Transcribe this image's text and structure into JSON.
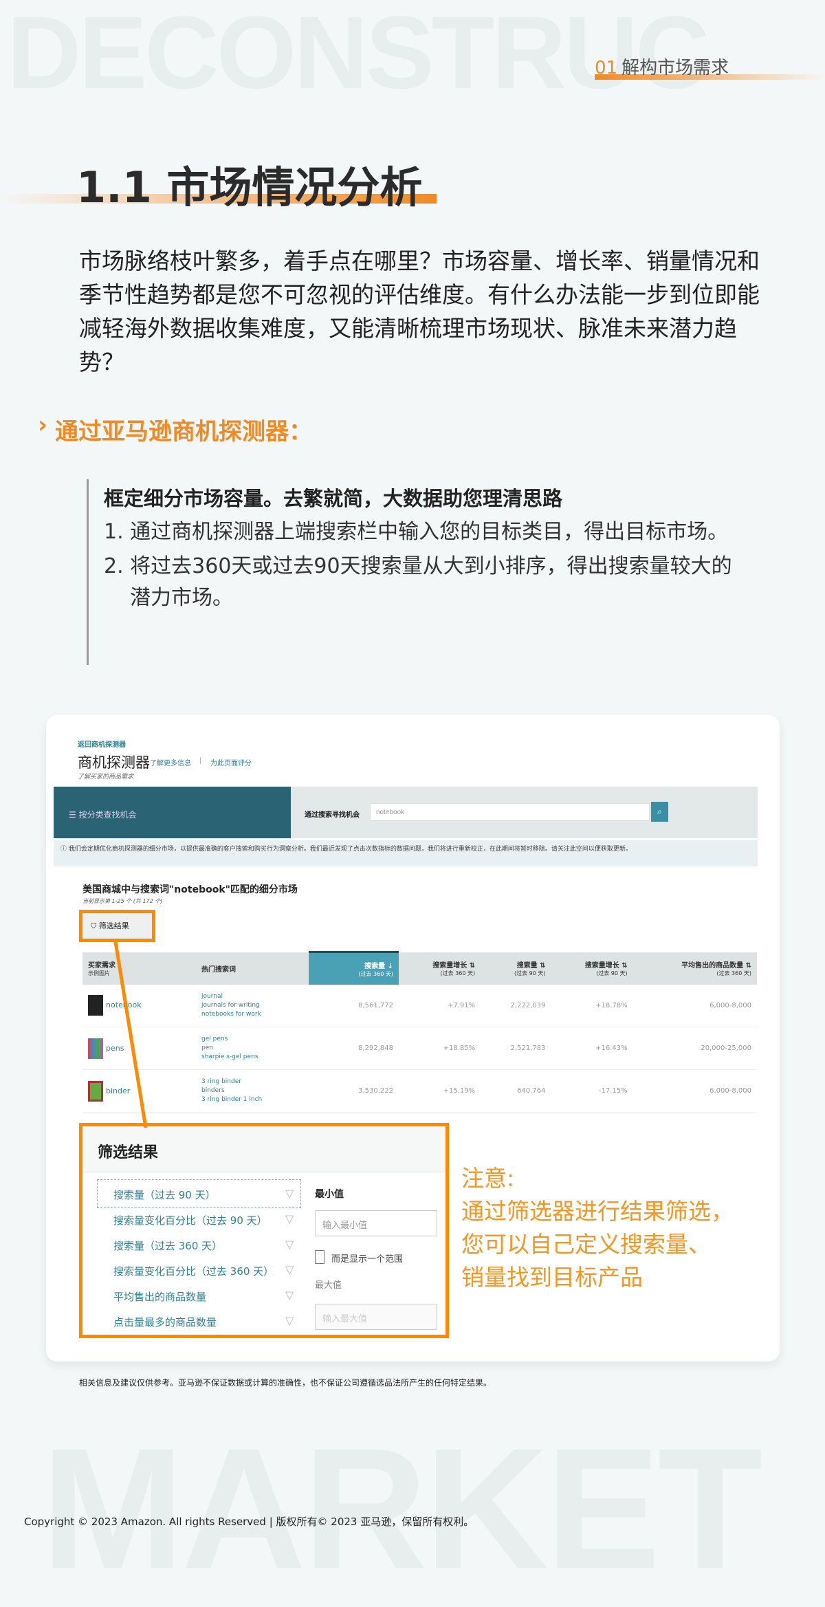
{
  "watermarks": {
    "top": "DECONSTRUC",
    "bottom": "MARKET"
  },
  "section": {
    "number": "01",
    "name": "解构市场需求"
  },
  "title": "1.1 市场情况分析",
  "intro": "市场脉络枝叶繁多，着手点在哪里？市场容量、增长率、销量情况和季节性趋势都是您不可忽视的评估维度。有什么办法能一步到位即能减轻海外数据收集难度，又能清晰梳理市场现状、脉准未来潜力趋势？",
  "subheading": "通过亚马逊商机探测器：",
  "step_box": {
    "heading": "框定细分市场容量。去繁就简，大数据助您理清思路",
    "items": [
      "1. 通过商机探测器上端搜索栏中输入您的目标类目，得出目标市场。",
      "2. 将过去360天或过去90天搜索量从大到小排序，得出搜索量较大的潜力市场。"
    ]
  },
  "tool": {
    "breadcrumb": "返回商机探测器",
    "name": "商机探测器",
    "link1": "了解更多信息",
    "link2": "为此页面评分",
    "tagline": "了解买家的商品需求",
    "browse_label": "按分类查找机会",
    "search_label": "通过搜索寻找机会",
    "search_value": "notebook",
    "info": "我们会定期优化商机探测器的细分市场，以提供最准确的客户搜索和购买行为洞察分析。我们最近发现了点击次数指标的数据问题，我们将进行重新校正，在此期间将暂时移除。请关注此空间以便获取更新。",
    "results_title": "美国商城中与搜索词\"notebook\"匹配的细分市场",
    "results_count": "当前显示第 1-25 个 (共 172 个)",
    "filter_button": "筛选结果",
    "columns": [
      {
        "h": "买家需求",
        "s": "示例图片"
      },
      {
        "h": "热门搜索词",
        "s": ""
      },
      {
        "h": "搜索量",
        "s": "(过去 360 天)"
      },
      {
        "h": "搜索量增长",
        "s": "(过去 360 天)"
      },
      {
        "h": "搜索量",
        "s": "(过去 90 天)"
      },
      {
        "h": "搜索量增长",
        "s": "(过去 90 天)"
      },
      {
        "h": "平均售出的商品数量",
        "s": "(过去 360 天)"
      }
    ],
    "rows": [
      {
        "name": "notebook",
        "kw": [
          "journal",
          "journals for writing",
          "notebooks for work"
        ],
        "v": [
          "8,561,772",
          "+7.91%",
          "2,222,039",
          "+18.78%",
          "6,000-8,000"
        ]
      },
      {
        "name": "pens",
        "kw": [
          "gel pens",
          "pen",
          "sharpie s-gel pens"
        ],
        "v": [
          "8,292,848",
          "+18.85%",
          "2,521,783",
          "+16.43%",
          "20,000-25,000"
        ]
      },
      {
        "name": "binder",
        "kw": [
          "3 ring binder",
          "binders",
          "3 ring binder 1 inch"
        ],
        "v": [
          "3,530,222",
          "+15.19%",
          "640,764",
          "-17.15%",
          "6,000-8,000"
        ]
      }
    ],
    "popup": {
      "title": "筛选结果",
      "filters": [
        "搜索量（过去 90 天）",
        "搜索量变化百分比（过去 90 天）",
        "搜索量（过去 360 天）",
        "搜索量变化百分比（过去 360 天）",
        "平均售出的商品数量",
        "点击量最多的商品数量"
      ],
      "min_label": "最小值",
      "min_placeholder": "输入最小值",
      "checkbox_label": "而是显示一个范围",
      "max_label": "最大值",
      "max_placeholder": "输入最大值"
    }
  },
  "note": [
    "注意:",
    "通过筛选器进行结果筛选，",
    "您可以自己定义搜索量、",
    "销量找到目标产品"
  ],
  "disclaimer": "相关信息及建议仅供参考。亚马逊不保证数据或计算的准确性，也不保证公司遵循选品法所产生的任何特定结果。",
  "copyright": "Copyright © 2023 Amazon. All rights Reserved | 版权所有© 2023 亚马逊，保留所有权利。",
  "colors": {
    "accent": "#f08a24",
    "highlight": "#ff8a00",
    "teal": "#2a6373"
  }
}
